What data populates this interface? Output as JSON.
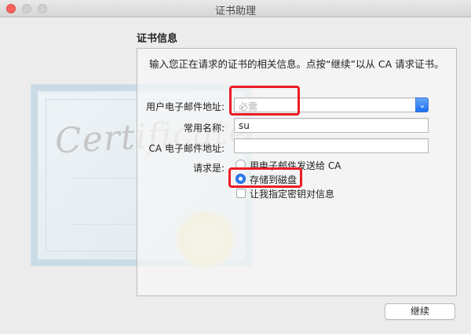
{
  "window": {
    "title": "证书助理"
  },
  "section_title": "证书信息",
  "intro_text": "输入您正在请求的证书的相关信息。点按“继续”以从 CA 请求证书。",
  "fields": {
    "email": {
      "label": "用户电子邮件地址:",
      "value": "",
      "placeholder": "必需"
    },
    "common_name": {
      "label": "常用名称:",
      "value": "su"
    },
    "ca_email": {
      "label": "CA 电子邮件地址:",
      "value": ""
    }
  },
  "request_is": {
    "label": "请求是:",
    "options": [
      {
        "label": "用电子邮件发送给 CA",
        "selected": false
      },
      {
        "label": "存储到磁盘",
        "selected": true
      }
    ],
    "checkbox": {
      "label": "让我指定密钥对信息",
      "checked": false
    }
  },
  "continue_label": "继续",
  "cert_art_text": "Certificate",
  "colors": {
    "accent": "#2f7bf4",
    "highlight": "#ec1c24"
  }
}
